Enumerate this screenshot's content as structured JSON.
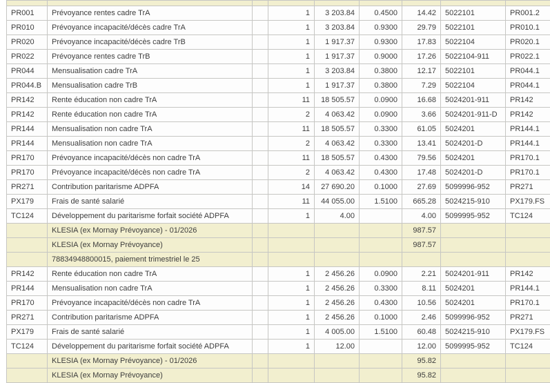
{
  "colors": {
    "summary_row_bg": "#f2efcf",
    "data_row_bg": "#fdfdfd",
    "grid_border": "#c6c6c3",
    "text": "#3d3d3d"
  },
  "table": {
    "rows": [
      {
        "type": "partial_top",
        "code": "",
        "label": "",
        "qty": "",
        "base": "",
        "rate": "",
        "amount": "",
        "account": "",
        "ref": ""
      },
      {
        "type": "data",
        "code": "PR001",
        "label": "Prévoyance rentes cadre TrA",
        "qty": "1",
        "base": "3 203.84",
        "rate": "0.4500",
        "amount": "14.42",
        "account": "5022101",
        "ref": "PR001.2"
      },
      {
        "type": "data",
        "code": "PR010",
        "label": "Prévoyance incapacité/décès cadre TrA",
        "qty": "1",
        "base": "3 203.84",
        "rate": "0.9300",
        "amount": "29.79",
        "account": "5022101",
        "ref": "PR010.1"
      },
      {
        "type": "data",
        "code": "PR020",
        "label": "Prévoyance incapacité/décès cadre TrB",
        "qty": "1",
        "base": "1 917.37",
        "rate": "0.9300",
        "amount": "17.83",
        "account": "5022104",
        "ref": "PR020.1"
      },
      {
        "type": "data",
        "code": "PR022",
        "label": "Prévoyance rentes cadre TrB",
        "qty": "1",
        "base": "1 917.37",
        "rate": "0.9000",
        "amount": "17.26",
        "account": "5022104-911",
        "ref": "PR022.1"
      },
      {
        "type": "data",
        "code": "PR044",
        "label": "Mensualisation cadre TrA",
        "qty": "1",
        "base": "3 203.84",
        "rate": "0.3800",
        "amount": "12.17",
        "account": "5022101",
        "ref": "PR044.1"
      },
      {
        "type": "data",
        "code": "PR044.B",
        "label": "Mensualisation cadre TrB",
        "qty": "1",
        "base": "1 917.37",
        "rate": "0.3800",
        "amount": "7.29",
        "account": "5022104",
        "ref": "PR044.1"
      },
      {
        "type": "data",
        "code": "PR142",
        "label": "Rente éducation non cadre TrA",
        "qty": "11",
        "base": "18 505.57",
        "rate": "0.0900",
        "amount": "16.68",
        "account": "5024201-911",
        "ref": "PR142"
      },
      {
        "type": "data",
        "code": "PR142",
        "label": "Rente éducation non cadre TrA",
        "qty": "2",
        "base": "4 063.42",
        "rate": "0.0900",
        "amount": "3.66",
        "account": "5024201-911-D",
        "ref": "PR142"
      },
      {
        "type": "data",
        "code": "PR144",
        "label": "Mensualisation non cadre TrA",
        "qty": "11",
        "base": "18 505.57",
        "rate": "0.3300",
        "amount": "61.05",
        "account": "5024201",
        "ref": "PR144.1"
      },
      {
        "type": "data",
        "code": "PR144",
        "label": "Mensualisation non cadre TrA",
        "qty": "2",
        "base": "4 063.42",
        "rate": "0.3300",
        "amount": "13.41",
        "account": "5024201-D",
        "ref": "PR144.1"
      },
      {
        "type": "data",
        "code": "PR170",
        "label": "Prévoyance incapacité/décès non cadre TrA",
        "qty": "11",
        "base": "18 505.57",
        "rate": "0.4300",
        "amount": "79.56",
        "account": "5024201",
        "ref": "PR170.1"
      },
      {
        "type": "data",
        "code": "PR170",
        "label": "Prévoyance incapacité/décès non cadre TrA",
        "qty": "2",
        "base": "4 063.42",
        "rate": "0.4300",
        "amount": "17.48",
        "account": "5024201-D",
        "ref": "PR170.1"
      },
      {
        "type": "data",
        "code": "PR271",
        "label": "Contribution paritarisme  ADPFA",
        "qty": "14",
        "base": "27 690.20",
        "rate": "0.1000",
        "amount": "27.69",
        "account": "5099996-952",
        "ref": "PR271"
      },
      {
        "type": "data",
        "code": "PX179",
        "label": "Frais de santé salarié",
        "qty": "11",
        "base": "44 055.00",
        "rate": "1.5100",
        "amount": "665.28",
        "account": "5024215-910",
        "ref": "PX179.FS"
      },
      {
        "type": "data",
        "code": "TC124",
        "label": "Développement du paritarisme forfait société ADPFA",
        "qty": "1",
        "base": "4.00",
        "rate": "",
        "amount": "4.00",
        "account": "5099995-952",
        "ref": "TC124"
      },
      {
        "type": "summary",
        "code": "",
        "label": "KLESIA (ex Mornay Prévoyance)  - 01/2026",
        "qty": "",
        "base": "",
        "rate": "",
        "amount": "987.57",
        "account": "",
        "ref": ""
      },
      {
        "type": "summary",
        "code": "",
        "label": "KLESIA (ex Mornay Prévoyance)",
        "qty": "",
        "base": "",
        "rate": "",
        "amount": "987.57",
        "account": "",
        "ref": ""
      },
      {
        "type": "info",
        "code": "",
        "label": "78834948800015, paiement trimestriel le 25",
        "qty": "",
        "base": "",
        "rate": "",
        "amount": "",
        "account": "",
        "ref": ""
      },
      {
        "type": "data",
        "code": "PR142",
        "label": "Rente éducation non cadre TrA",
        "qty": "1",
        "base": "2 456.26",
        "rate": "0.0900",
        "amount": "2.21",
        "account": "5024201-911",
        "ref": "PR142"
      },
      {
        "type": "data",
        "code": "PR144",
        "label": "Mensualisation non cadre TrA",
        "qty": "1",
        "base": "2 456.26",
        "rate": "0.3300",
        "amount": "8.11",
        "account": "5024201",
        "ref": "PR144.1"
      },
      {
        "type": "data",
        "code": "PR170",
        "label": "Prévoyance incapacité/décès non cadre TrA",
        "qty": "1",
        "base": "2 456.26",
        "rate": "0.4300",
        "amount": "10.56",
        "account": "5024201",
        "ref": "PR170.1"
      },
      {
        "type": "data",
        "code": "PR271",
        "label": "Contribution paritarisme  ADPFA",
        "qty": "1",
        "base": "2 456.26",
        "rate": "0.1000",
        "amount": "2.46",
        "account": "5099996-952",
        "ref": "PR271"
      },
      {
        "type": "data",
        "code": "PX179",
        "label": "Frais de santé salarié",
        "qty": "1",
        "base": "4 005.00",
        "rate": "1.5100",
        "amount": "60.48",
        "account": "5024215-910",
        "ref": "PX179.FS"
      },
      {
        "type": "data",
        "code": "TC124",
        "label": "Développement du paritarisme forfait société ADPFA",
        "qty": "1",
        "base": "12.00",
        "rate": "",
        "amount": "12.00",
        "account": "5099995-952",
        "ref": "TC124"
      },
      {
        "type": "summary",
        "code": "",
        "label": "KLESIA (ex Mornay Prévoyance)  - 01/2026",
        "qty": "",
        "base": "",
        "rate": "",
        "amount": "95.82",
        "account": "",
        "ref": ""
      },
      {
        "type": "summary_partial",
        "code": "",
        "label": "KLESIA (ex Mornay Prévoyance)",
        "qty": "",
        "base": "",
        "rate": "",
        "amount": "95.82",
        "account": "",
        "ref": ""
      }
    ]
  }
}
